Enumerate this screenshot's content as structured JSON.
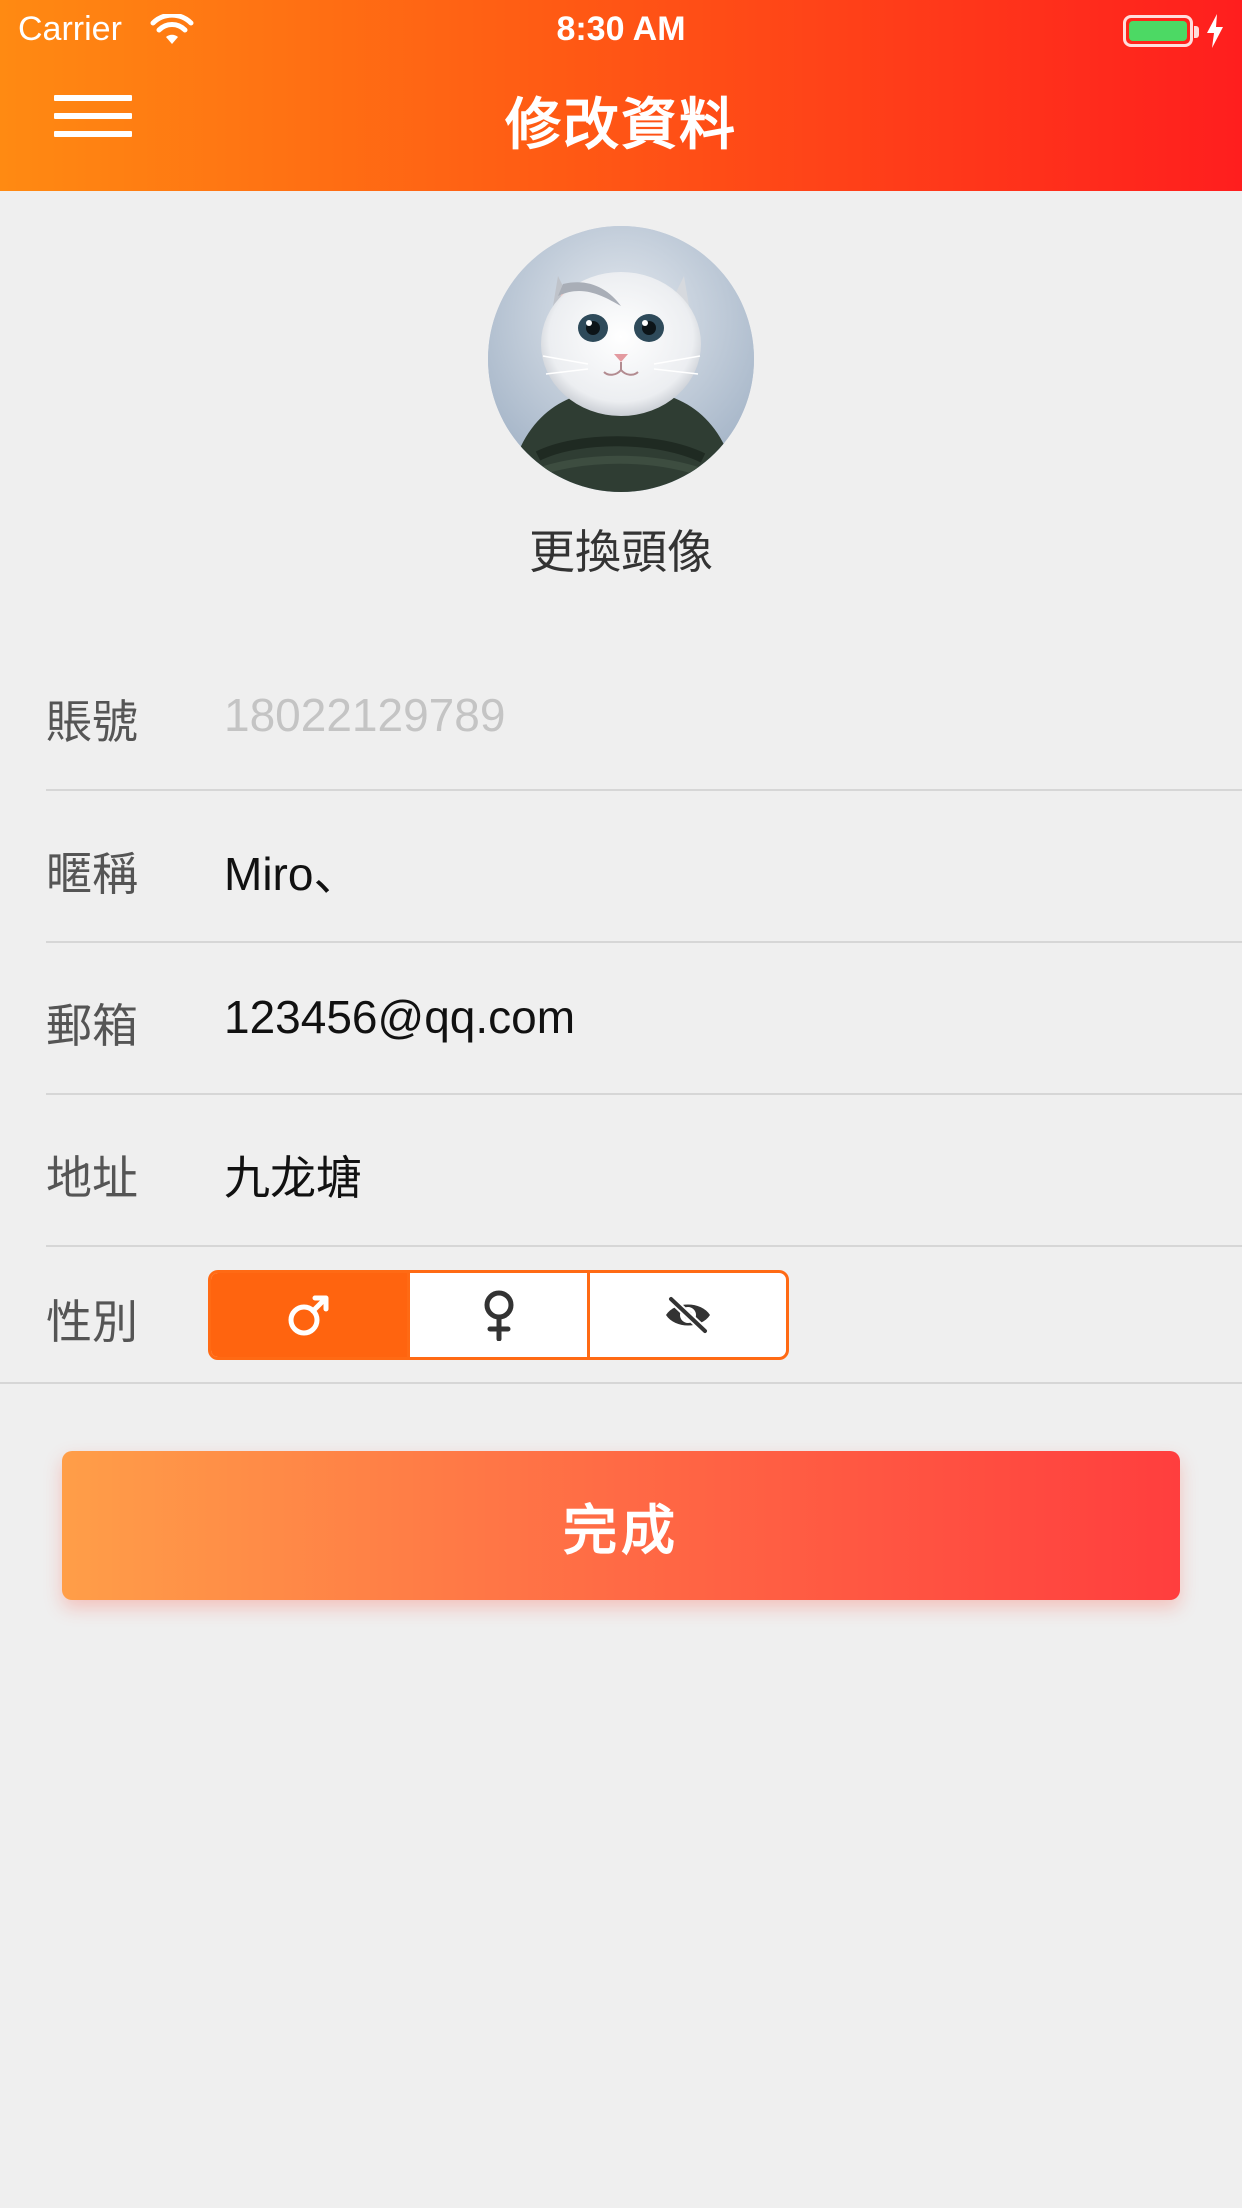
{
  "status_bar": {
    "carrier": "Carrier",
    "time": "8:30 AM"
  },
  "header": {
    "title": "修改資料",
    "menu_icon": "hamburger-menu-icon",
    "gradient": [
      "#ff8a12",
      "#ff1e1e"
    ]
  },
  "avatar": {
    "image": "white-cat-photo",
    "change_label": "更換頭像"
  },
  "form": {
    "account": {
      "label": "賬號",
      "placeholder": "18022129789",
      "value": ""
    },
    "nickname": {
      "label": "暱稱",
      "value": "Miro、"
    },
    "email": {
      "label": "郵箱",
      "value": "123456@qq.com"
    },
    "address": {
      "label": "地址",
      "value": "九龙塘"
    },
    "gender": {
      "label": "性別",
      "options": [
        "male-icon",
        "female-icon",
        "eye-slash-icon"
      ],
      "selected": "male-icon",
      "accent": "#ff640f"
    }
  },
  "done_button": {
    "label": "完成"
  }
}
